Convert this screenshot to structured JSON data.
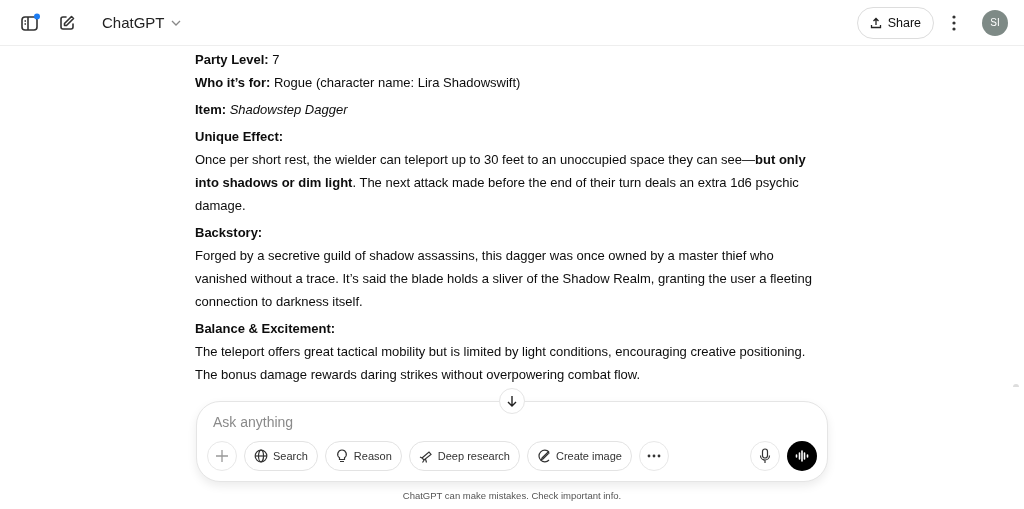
{
  "header": {
    "title": "ChatGPT",
    "share": "Share",
    "avatar": "SI",
    "notification": true
  },
  "message": [
    [
      {
        "kind": "line",
        "text": "**Party Level:** 7"
      },
      {
        "kind": "line",
        "text": "**Who it’s for:** Rogue (character name: Lira Shadowswift)"
      }
    ],
    [
      {
        "kind": "line",
        "text": "**Item:** *Shadowstep Dagger*"
      }
    ],
    [
      {
        "kind": "heading",
        "text": "Unique Effect:"
      },
      {
        "kind": "body",
        "text": "Once per short rest, the wielder can teleport up to 30 feet to an unoccupied space they can see—**but only into shadows or dim light**. The next attack made before the end of their turn deals an extra 1d6 psychic damage."
      }
    ],
    [
      {
        "kind": "heading",
        "text": "Backstory:"
      },
      {
        "kind": "body",
        "text": "Forged by a secretive guild of shadow assassins, this dagger was once owned by a master thief who vanished without a trace. It’s said the blade holds a sliver of the Shadow Realm, granting the user a fleeting connection to darkness itself."
      }
    ],
    [
      {
        "kind": "heading",
        "text": "Balance & Excitement:"
      },
      {
        "kind": "body",
        "text": "The teleport offers great tactical mobility but is limited by light conditions, encouraging creative positioning. The bonus damage rewards daring strikes without overpowering combat flow."
      }
    ]
  ],
  "composer": {
    "placeholder": "Ask anything",
    "tools": [
      {
        "kind": "search",
        "label": "Search"
      },
      {
        "kind": "reason",
        "label": "Reason"
      },
      {
        "kind": "research",
        "label": "Deep research"
      },
      {
        "kind": "image",
        "label": "Create image"
      }
    ]
  },
  "disclaimer": "ChatGPT can make mistakes. Check important info."
}
